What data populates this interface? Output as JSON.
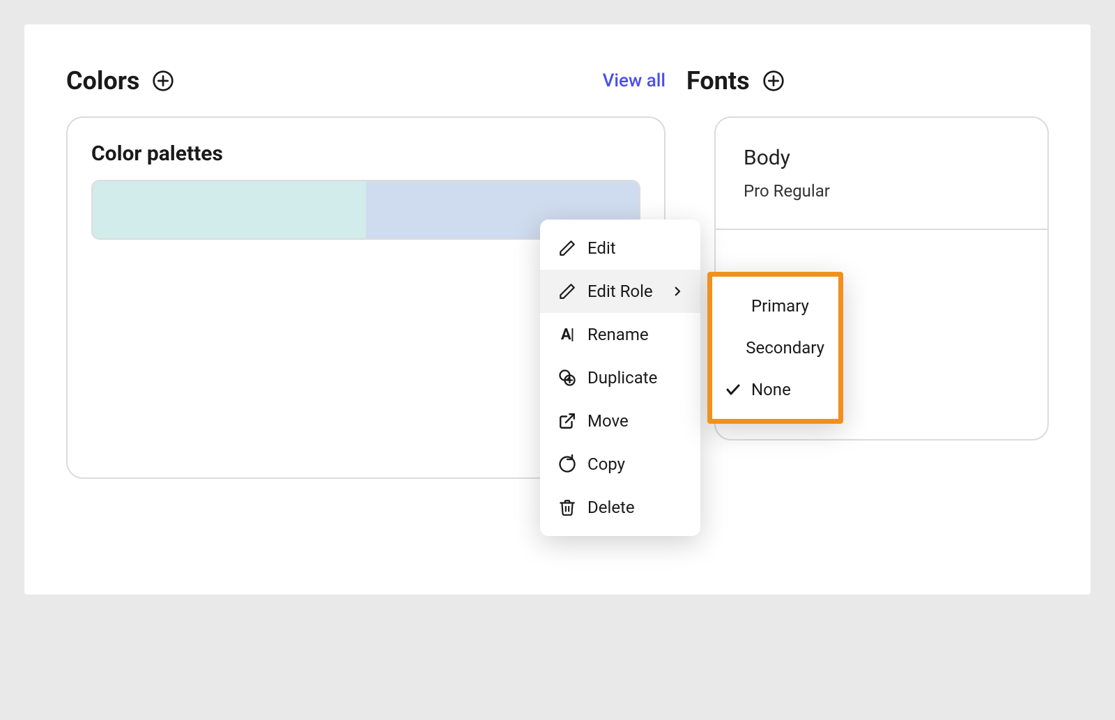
{
  "colors": {
    "title": "Colors",
    "view_all_label": "View all",
    "palettes_heading": "Color palettes",
    "palette_swatches": [
      "#d1ecea",
      "#cfdbee"
    ]
  },
  "fonts": {
    "title": "Fonts",
    "body_label": "Body",
    "body_font_name_fragment": "Pro Regular"
  },
  "context_menu": {
    "edit": "Edit",
    "edit_role": "Edit Role",
    "rename": "Rename",
    "duplicate": "Duplicate",
    "move": "Move",
    "copy": "Copy",
    "delete": "Delete"
  },
  "role_submenu": {
    "primary": "Primary",
    "secondary": "Secondary",
    "none": "None",
    "selected": "none"
  },
  "highlight_color": "#f0911e"
}
